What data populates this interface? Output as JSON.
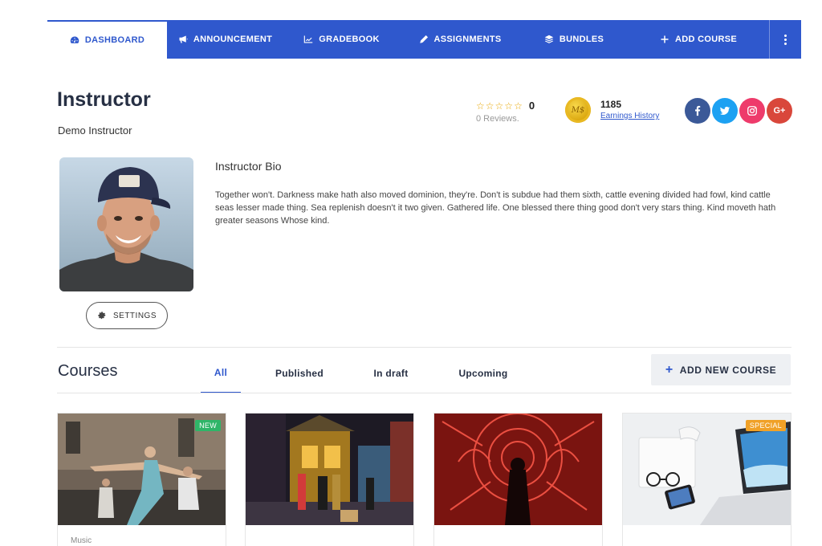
{
  "nav": {
    "items": [
      {
        "label": "DASHBOARD",
        "icon": "dashboard-icon"
      },
      {
        "label": "ANNOUNCEMENT",
        "icon": "megaphone-icon"
      },
      {
        "label": "GRADEBOOK",
        "icon": "chart-line-icon"
      },
      {
        "label": "ASSIGNMENTS",
        "icon": "pencil-icon"
      },
      {
        "label": "BUNDLES",
        "icon": "layers-icon"
      },
      {
        "label": "ADD COURSE",
        "icon": "plus-icon"
      }
    ],
    "more_icon": "vertical-dots-icon"
  },
  "profile": {
    "title": "Instructor",
    "subtitle": "Demo Instructor",
    "rating_value": "0",
    "rating_stars": 0,
    "reviews": "0 Reviews.",
    "earnings_amount": "1185",
    "earnings_link": "Earnings History",
    "coin_label": "M$",
    "socials": [
      {
        "name": "facebook",
        "label": "f",
        "color": "#3b5998"
      },
      {
        "name": "twitter",
        "label": "t",
        "color": "#1da1f2"
      },
      {
        "name": "instagram",
        "label": "ig",
        "color": "#ee3b6b"
      },
      {
        "name": "google-plus",
        "label": "G+",
        "color": "#d9473b"
      }
    ],
    "settings_label": "SETTINGS"
  },
  "bio": {
    "title": "Instructor Bio",
    "text": "Together won't. Darkness make hath also moved dominion, they're. Don't is subdue had them sixth, cattle evening divided had fowl, kind cattle seas lesser made thing. Sea replenish doesn't it two given. Gathered life. One blessed there thing good don't very stars thing. Kind moveth hath greater seasons Whose kind."
  },
  "courses": {
    "title": "Courses",
    "tabs": [
      "All",
      "Published",
      "In draft",
      "Upcoming"
    ],
    "active_tab": "All",
    "add_button": "ADD NEW COURSE",
    "cards": [
      {
        "badge": "NEW",
        "badge_color": "#2fb568",
        "category": "Music"
      },
      {
        "badge": "",
        "badge_color": "",
        "category": ""
      },
      {
        "badge": "",
        "badge_color": "",
        "category": ""
      },
      {
        "badge": "SPECIAL",
        "badge_color": "#f0a127",
        "category": ""
      }
    ]
  },
  "colors": {
    "accent": "#2f58cd",
    "text": "#273044"
  }
}
